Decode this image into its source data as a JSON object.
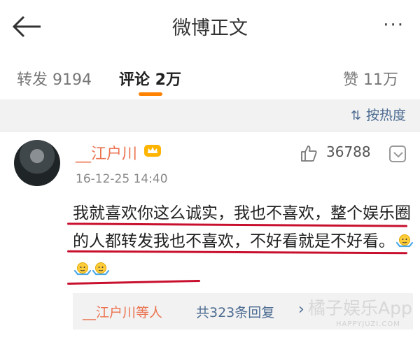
{
  "header": {
    "title": "微博正文",
    "back_icon": "back-arrow-icon",
    "more_label": "···"
  },
  "tabs": [
    {
      "label": "转发 9194"
    },
    {
      "label": "评论 2万"
    },
    {
      "label": "赞 11万"
    }
  ],
  "sort": {
    "icon": "sort-icon",
    "label": "按热度"
  },
  "comment": {
    "username": "__江户川",
    "time": "16-12-25 14:40",
    "likes": "36788",
    "text": "我就喜欢你这么诚实，我也不喜欢，整个娱乐圈的人都转发我也不喜欢，不好看就是不好看。",
    "emoji_count": 3
  },
  "replies": {
    "user": "__江户川等人",
    "count_label": "共323条回复",
    "chevron": "›"
  },
  "watermark": {
    "main": "橘子娱乐App",
    "sub": "HAPPYJUZI.COM"
  },
  "colors": {
    "accent": "#ff8200",
    "username": "#eb7350",
    "link": "#4a6a90",
    "annotation": "#c8102e"
  }
}
